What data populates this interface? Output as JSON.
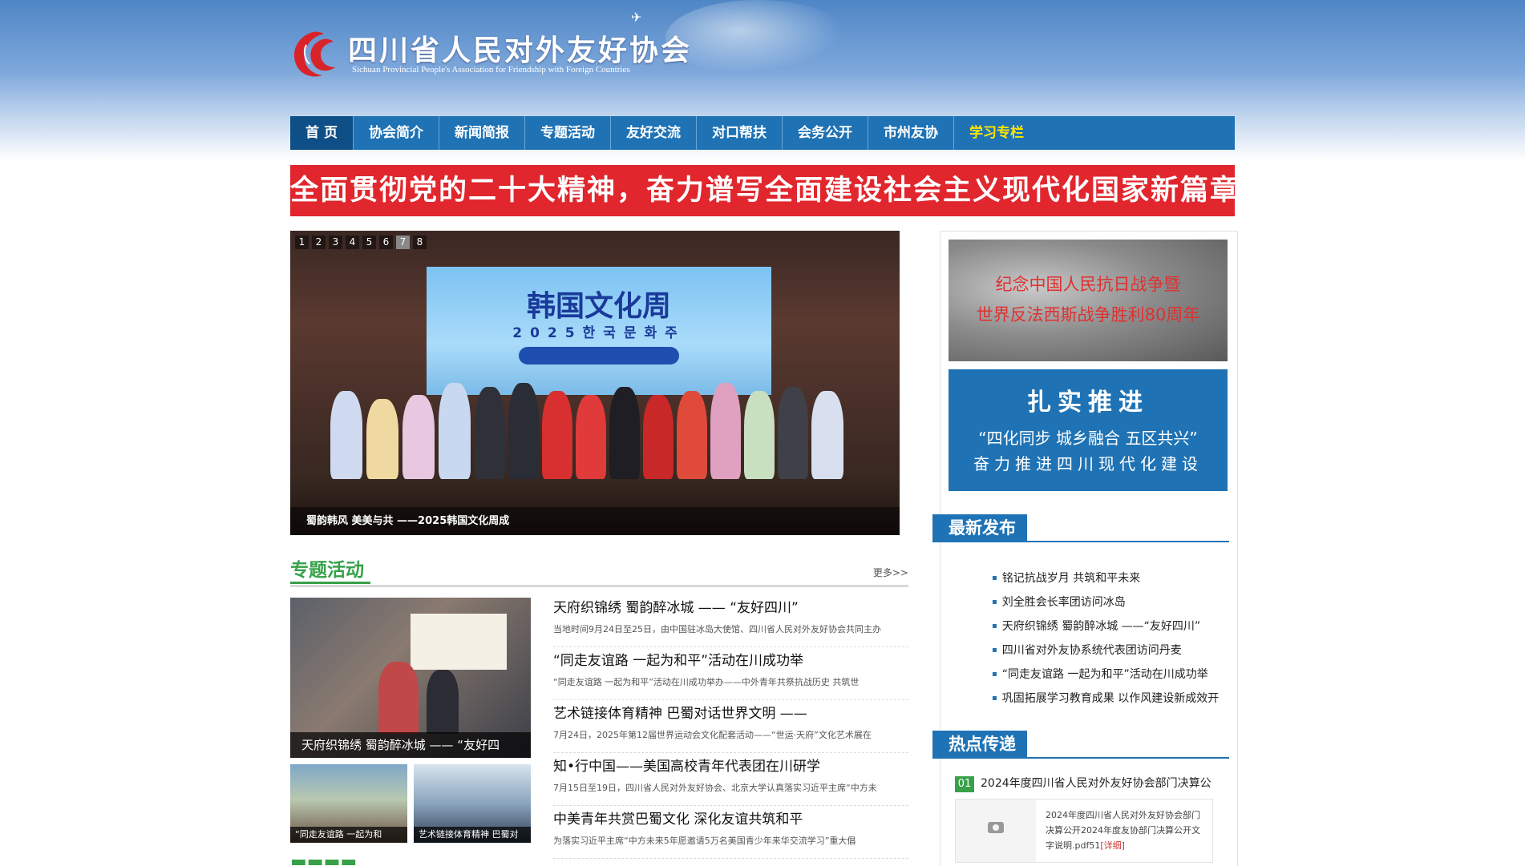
{
  "header": {
    "org_name_cn": "四川省人民对外友好协会",
    "org_name_en": "Sichuan Provincial People's Association for Friendship with Foreign Countries"
  },
  "nav": {
    "items": [
      {
        "label": "首 页"
      },
      {
        "label": "协会简介"
      },
      {
        "label": "新闻简报"
      },
      {
        "label": "专题活动"
      },
      {
        "label": "友好交流"
      },
      {
        "label": "对口帮扶"
      },
      {
        "label": "会务公开"
      },
      {
        "label": "市州友协"
      },
      {
        "label": "学习专栏"
      }
    ],
    "active_index": 0
  },
  "banner": {
    "text": "全面贯彻党的二十大精神，奋力谱写全面建设社会主义现代化国家新篇章"
  },
  "slider": {
    "numbers": [
      "1",
      "2",
      "3",
      "4",
      "5",
      "6",
      "7",
      "8"
    ],
    "active": "7",
    "screen_title": "韩国文化周",
    "screen_sub": "2025한국문화주",
    "caption": "蜀韵韩风 美美与共 ——2025韩国文化周成"
  },
  "topic": {
    "title": "专题活动",
    "more": "更多>>",
    "big_caption": "天府织锦绣 蜀韵醉冰城 —— “友好四",
    "small_captions": [
      "“同走友谊路 一起为和",
      "艺术链接体育精神 巴蜀对"
    ],
    "news": [
      {
        "title": "天府织锦绣 蜀韵醉冰城 —— “友好四川”",
        "summary": "当地时间9月24日至25日，由中国驻冰岛大使馆、四川省人民对外友好协会共同主办"
      },
      {
        "title": "“同走友谊路 一起为和平”活动在川成功举",
        "summary": "“同走友谊路 一起为和平”活动在川成功举办——中外青年共祭抗战历史 共筑世"
      },
      {
        "title": "艺术链接体育精神 巴蜀对话世界文明 ——",
        "summary": "7月24日，2025年第12届世界运动会文化配套活动——“世运·天府”文化艺术展在"
      },
      {
        "title": "知•行中国——美国高校青年代表团在川研学",
        "summary": "7月15日至19日，四川省人民对外友好协会、北京大学认真落实习近平主席“中方未"
      },
      {
        "title": "中美青年共赏巴蜀文化 深化友谊共筑和平",
        "summary": "为落实习近平主席“中方未来5年愿邀请5万名美国青少年来华交流学习”重大倡"
      }
    ]
  },
  "right": {
    "ad1": {
      "line1": "纪念中国人民抗日战争暨",
      "line2": "世界反法西斯战争胜利80周年"
    },
    "ad2": {
      "title": "扎实推进",
      "line1": "“四化同步  城乡融合  五区共兴”",
      "line2": "奋力推进四川现代化建设"
    },
    "latest": {
      "title": "最新发布",
      "items": [
        "铭记抗战岁月 共筑和平未来",
        "刘全胜会长率团访问冰岛",
        "天府织锦绣 蜀韵醉冰城 ——“友好四川”",
        "四川省对外友协系统代表团访问丹麦",
        "“同走友谊路 一起为和平”活动在川成功举",
        "巩固拓展学习教育成果 以作风建设新成效开"
      ]
    },
    "hot": {
      "title": "热点传递",
      "number": "01",
      "item_title": "2024年度四川省人民对外友好协会部门决算公",
      "desc": "2024年度四川省人民对外友好协会部门决算公开2024年度友协部门决算公开文字说明.pdf51",
      "more": "[详细]"
    }
  },
  "colors": {
    "nav_blue": "#1f73b5",
    "nav_active": "#0f4f87",
    "banner_red": "#e1262d",
    "topic_green": "#36a148",
    "gold": "#ffe600"
  }
}
